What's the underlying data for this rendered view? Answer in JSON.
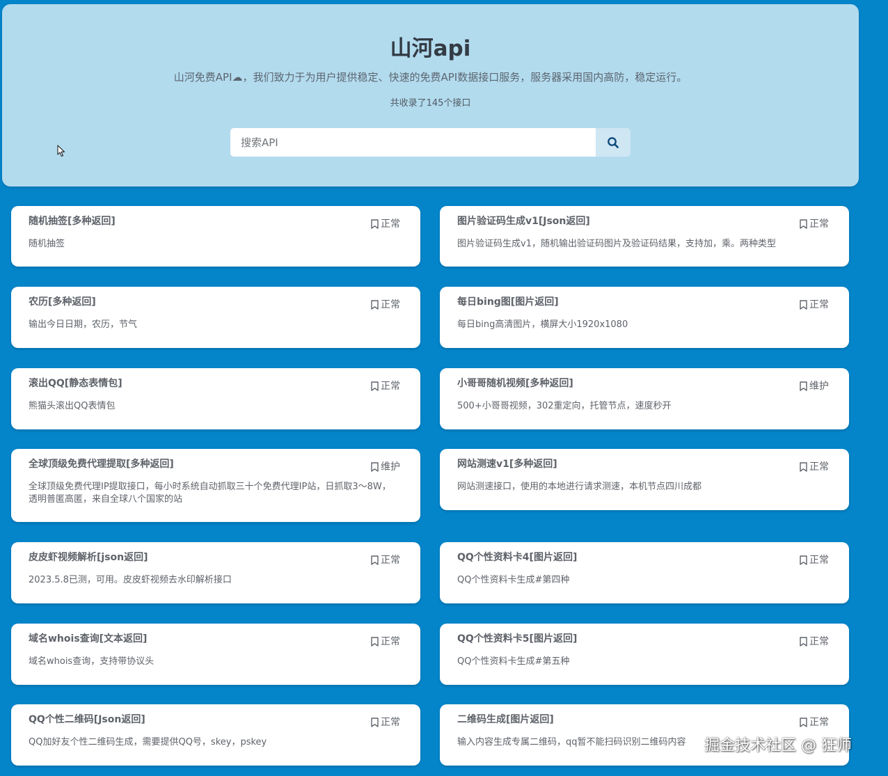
{
  "header": {
    "title": "山河api",
    "subtitle": "山河免费API☁，我们致力于为用户提供稳定、快速的免费API数据接口服务，服务器采用国内高防，稳定运行。",
    "count_text": "共收录了145个接口"
  },
  "search": {
    "placeholder": "搜索API",
    "button_icon": "search-icon"
  },
  "cards": [
    {
      "title": "随机抽签[多种返回]",
      "status": "正常",
      "desc": "随机抽签"
    },
    {
      "title": "图片验证码生成v1[Json返回]",
      "status": "正常",
      "desc": "图片验证码生成v1，随机输出验证码图片及验证码结果，支持加，乘。两种类型"
    },
    {
      "title": "农历[多种返回]",
      "status": "正常",
      "desc": "输出今日日期，农历，节气"
    },
    {
      "title": "每日bing图[图片返回]",
      "status": "正常",
      "desc": "每日bing高清图片，横屏大小1920x1080"
    },
    {
      "title": "滚出QQ[静态表情包]",
      "status": "正常",
      "desc": "熊猫头滚出QQ表情包"
    },
    {
      "title": "小哥哥随机视频[多种返回]",
      "status": "维护",
      "desc": "500+小哥哥视频，302重定向，托管节点，速度秒开"
    },
    {
      "title": "全球顶级免费代理提取[多种返回]",
      "status": "维护",
      "desc": "全球顶级免费代理IP提取接口，每小时系统自动抓取三十个免费代理IP站，日抓取3～8W，透明普匿高匿，来自全球八个国家的站"
    },
    {
      "title": "网站测速v1[多种返回]",
      "status": "正常",
      "desc": "网站测速接口，使用的本地进行请求测速，本机节点四川成都"
    },
    {
      "title": "皮皮虾视频解析[json返回]",
      "status": "正常",
      "desc": "2023.5.8已测，可用。皮皮虾视频去水印解析接口"
    },
    {
      "title": "QQ个性资料卡4[图片返回]",
      "status": "正常",
      "desc": "QQ个性资料卡生成#第四种"
    },
    {
      "title": "域名whois查询[文本返回]",
      "status": "正常",
      "desc": "域名whois查询，支持带协议头"
    },
    {
      "title": "QQ个性资料卡5[图片返回]",
      "status": "正常",
      "desc": "QQ个性资料卡生成#第五种"
    },
    {
      "title": "QQ个性二维码[Json返回]",
      "status": "正常",
      "desc": "QQ加好友个性二维码生成，需要提供QQ号，skey，pskey"
    },
    {
      "title": "二维码生成[图片返回]",
      "status": "正常",
      "desc": "输入内容生成专属二维码，qq暂不能扫码识别二维码内容"
    }
  ],
  "watermark": "掘金技术社区 @ 狂师",
  "colors": {
    "background": "#0484c9",
    "header_panel": "#b3dbee",
    "card_bg": "#ffffff",
    "text": "#5e6269"
  }
}
